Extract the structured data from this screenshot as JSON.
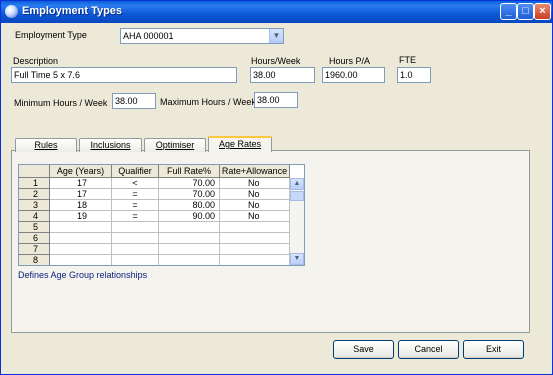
{
  "window": {
    "title": "Employment Types",
    "minimize": "_",
    "maximize": "□",
    "close": "×"
  },
  "form": {
    "employment_type_label": "Employment Type",
    "employment_type_value": "AHA 000001",
    "description_label": "Description",
    "description_value": "Full Time 5 x 7.6",
    "hours_week_label": "Hours/Week",
    "hours_week_value": "38.00",
    "hours_pa_label": "Hours P/A",
    "hours_pa_value": "1960.00",
    "fte_label": "FTE",
    "fte_value": "1.0",
    "min_hours_label": "Minimum Hours / Week",
    "min_hours_value": "38.00",
    "max_hours_label": "Maximum Hours / Week",
    "max_hours_value": "38.00"
  },
  "tabs": [
    {
      "label": "Rules"
    },
    {
      "label": "Inclusions"
    },
    {
      "label": "Optimiser"
    },
    {
      "label": "Age Rates"
    }
  ],
  "grid": {
    "columns": [
      "Age (Years)",
      "Qualifier",
      "Full Rate%",
      "Rate+Allowance"
    ],
    "row_numbers": [
      "1",
      "2",
      "3",
      "4",
      "5",
      "6",
      "7",
      "8"
    ],
    "rows": [
      [
        "17",
        "<",
        "70.00",
        "No"
      ],
      [
        "17",
        "=",
        "70.00",
        "No"
      ],
      [
        "18",
        "=",
        "80.00",
        "No"
      ],
      [
        "19",
        "=",
        "90.00",
        "No"
      ]
    ]
  },
  "hint": "Defines Age Group relationships",
  "buttons": {
    "save": "Save",
    "cancel": "Cancel",
    "exit": "Exit"
  },
  "icons": {
    "combo": "chevron-down-icon",
    "scroll_up": "up-arrow-icon",
    "scroll_down": "down-arrow-icon"
  }
}
